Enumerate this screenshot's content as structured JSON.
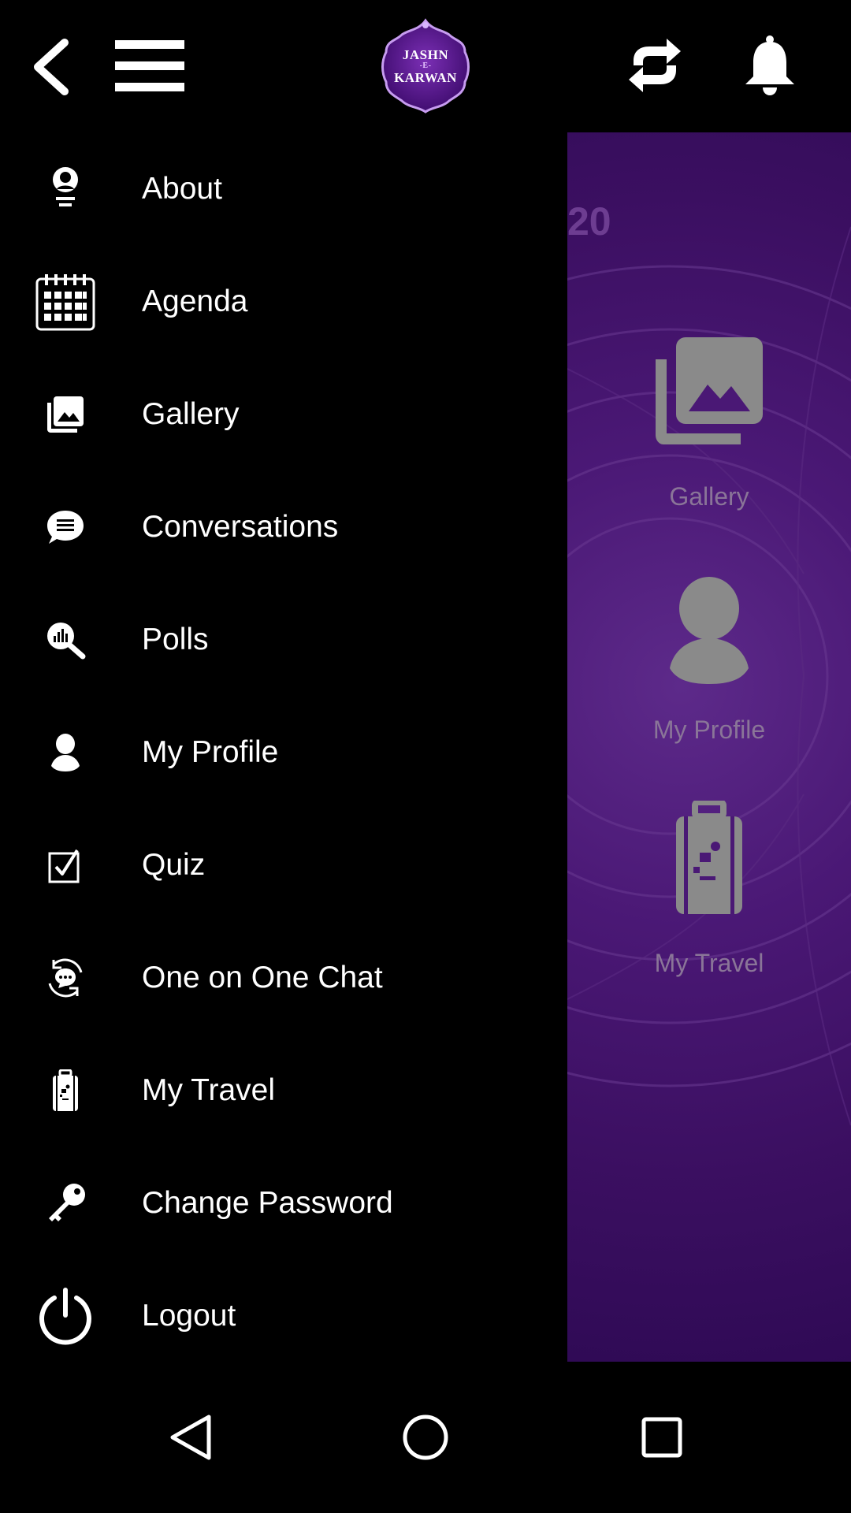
{
  "header": {
    "logo_text_line1": "JASHN",
    "logo_text_sep": "-E-",
    "logo_text_line2": "KARWAN",
    "icons": [
      "back-arrow-icon",
      "hamburger-menu-icon",
      "refresh-icon",
      "bell-icon"
    ]
  },
  "drawer": {
    "items": [
      {
        "label": "About",
        "icon": "about-person-icon"
      },
      {
        "label": "Agenda",
        "icon": "calendar-icon"
      },
      {
        "label": "Gallery",
        "icon": "gallery-icon"
      },
      {
        "label": "Conversations",
        "icon": "chat-bubble-icon"
      },
      {
        "label": "Polls",
        "icon": "poll-search-icon"
      },
      {
        "label": "My Profile",
        "icon": "person-icon"
      },
      {
        "label": "Quiz",
        "icon": "checkbox-icon"
      },
      {
        "label": "One on One Chat",
        "icon": "chat-cycle-icon"
      },
      {
        "label": "My Travel",
        "icon": "luggage-icon"
      },
      {
        "label": "Change Password",
        "icon": "key-icon"
      },
      {
        "label": "Logout",
        "icon": "power-icon"
      }
    ]
  },
  "background_page": {
    "year_fragment": "20",
    "tiles": [
      {
        "label": "Gallery",
        "icon": "gallery-icon"
      },
      {
        "label": "My Profile",
        "icon": "person-icon"
      },
      {
        "label": "My Travel",
        "icon": "luggage-icon"
      }
    ]
  },
  "navbar": {
    "icons": [
      "nav-back-icon",
      "nav-home-icon",
      "nav-recents-icon"
    ]
  },
  "colors": {
    "background": "#000000",
    "accent_purple": "#4a1875",
    "tile_gray": "#8a8a8a"
  }
}
